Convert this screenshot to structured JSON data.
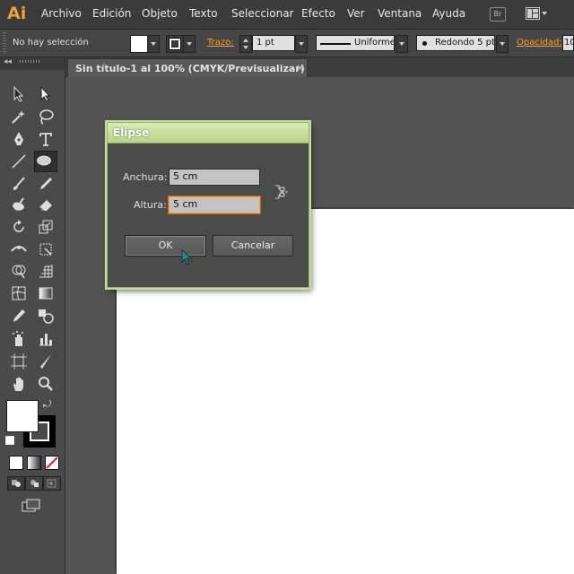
{
  "app": {
    "logo": "Ai"
  },
  "menu": {
    "items": [
      "Archivo",
      "Edición",
      "Objeto",
      "Texto",
      "Seleccionar",
      "Efecto",
      "Ver",
      "Ventana",
      "Ayuda"
    ],
    "bridge_badge": "Br",
    "workspace_icon": "workspace-switcher-icon"
  },
  "control_bar": {
    "selection_status": "No hay selección",
    "fill_color": "#ffffff",
    "stroke_label": "Trazo:",
    "stroke_weight": "1 pt",
    "stroke_profile": "Uniforme",
    "brush": "Redondo 5 pt.",
    "opacity_label": "Opacidad:",
    "opacity_value": "10",
    "accent_color": "#ff9d2e"
  },
  "document": {
    "tab_title": "Sin título-1 al 100% (CMYK/Previsualizar)",
    "close_glyph": "×"
  },
  "dialog": {
    "title": "Elipse",
    "width_label": "Anchura:",
    "width_value": "5 cm",
    "height_label": "Altura:",
    "height_value": "5 cm",
    "constrain_icon": "link-proportions-icon",
    "ok_label": "OK",
    "cancel_label": "Cancelar"
  },
  "tools": [
    "selection-tool",
    "direct-selection-tool",
    "magic-wand-tool",
    "lasso-tool",
    "pen-tool",
    "type-tool",
    "line-segment-tool",
    "ellipse-tool",
    "paintbrush-tool",
    "pencil-tool",
    "blob-brush-tool",
    "eraser-tool",
    "rotate-tool",
    "scale-tool",
    "width-tool",
    "free-transform-tool",
    "shape-builder-tool",
    "perspective-grid-tool",
    "mesh-tool",
    "gradient-tool",
    "eyedropper-tool",
    "blend-tool",
    "symbol-sprayer-tool",
    "column-graph-tool",
    "artboard-tool",
    "slice-tool",
    "hand-tool",
    "zoom-tool"
  ]
}
